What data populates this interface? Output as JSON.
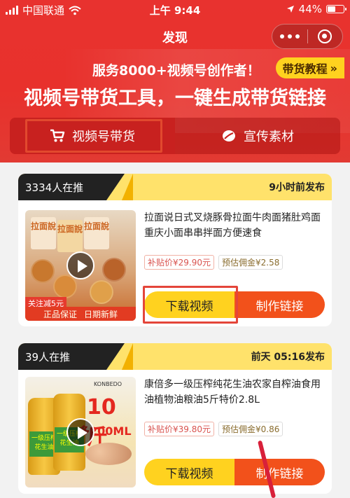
{
  "status_bar": {
    "carrier": "中国联通",
    "time": "上午 9:44",
    "battery": "44%",
    "battery_level": 0.44
  },
  "nav": {
    "title": "发现"
  },
  "banner": {
    "promo": "服务8000+视频号创作者！",
    "tutorial_label": "带货教程",
    "headline": "视频号带货工具，一键生成带货链接"
  },
  "tabs": [
    {
      "label": "视频号带货",
      "icon": "cart-icon",
      "active": true
    },
    {
      "label": "宣传素材",
      "icon": "leaf-icon",
      "active": false
    }
  ],
  "products": [
    {
      "promoters": "3334人在推",
      "publish_time": "9小时前发布",
      "title": "拉面说日式叉烧豚骨拉面牛肉面猪肚鸡面重庆小面串串拌面方便速食",
      "subsidy_price": "补贴价¥29.90元",
      "commission": "预估佣金¥2.58",
      "thumb_pkg_text": "拉面說",
      "thumb_tag": "关注减5元",
      "thumb_band_1": "正品保证",
      "thumb_band_2": "日期新鲜",
      "download_label": "下载视频",
      "make_link_label": "制作链接"
    },
    {
      "promoters": "39人在推",
      "publish_time": "前天 05:16发布",
      "title": "康倍多一级压榨纯花生油农家自榨油食用油植物油粮油5斤特价2.8L",
      "subsidy_price": "补贴价¥39.80元",
      "commission": "预估佣金¥0.86",
      "thumb_big": "10斤",
      "thumb_sub": "多200ML",
      "thumb_label": "一级压榨花生油",
      "download_label": "下载视频",
      "make_link_label": "制作链接"
    }
  ],
  "colors": {
    "header_red": "#e8322f",
    "yellow": "#ffd21f",
    "orange": "#f2511b"
  }
}
